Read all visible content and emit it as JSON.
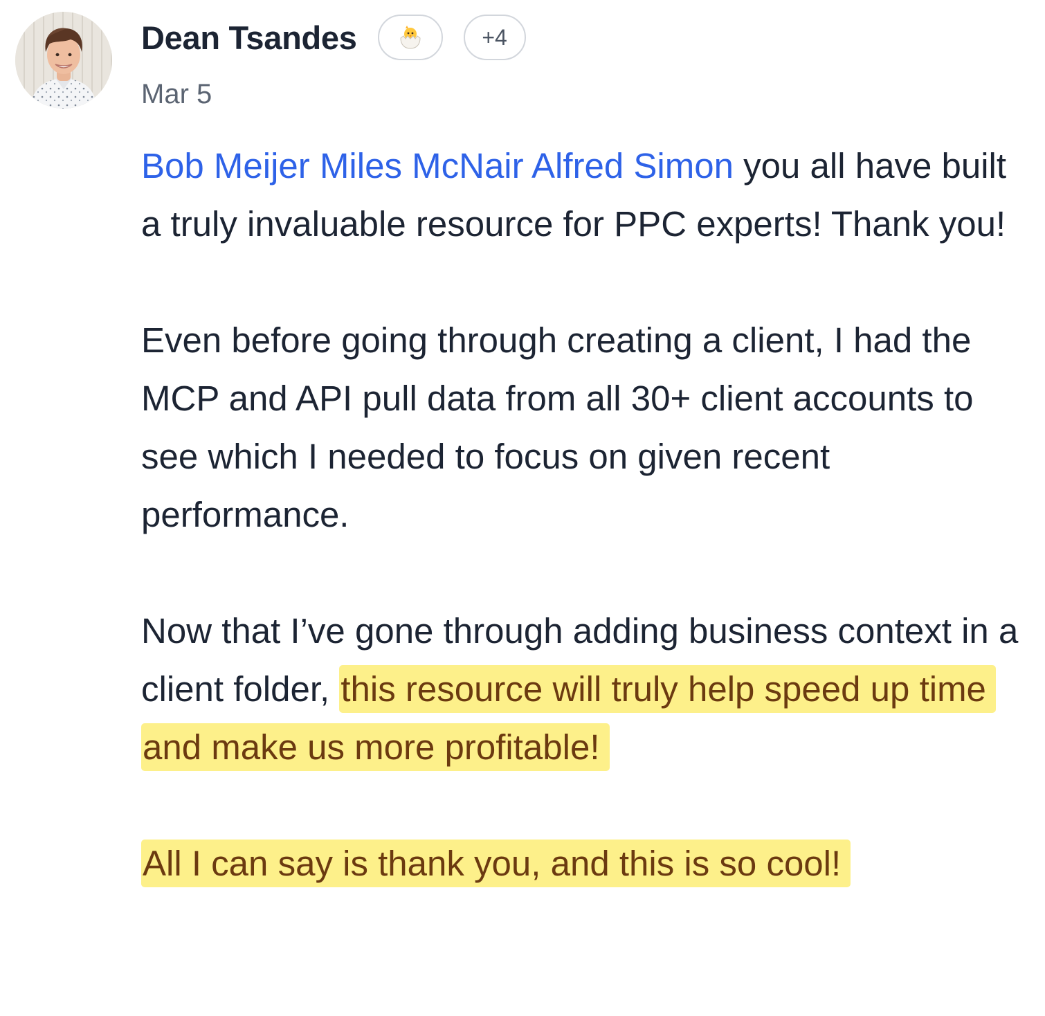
{
  "author": {
    "name": "Dean Tsandes",
    "date": "Mar 5",
    "avatar_icon": "profile-photo",
    "badges": [
      {
        "icon": "hatching-chick-emoji",
        "glyph": "🐣"
      },
      {
        "label": "+4"
      }
    ]
  },
  "post": {
    "paragraph1": {
      "mentions": [
        "Bob Meijer",
        "Miles McNair",
        "Alfred Simon"
      ],
      "text": " you all have built a truly invaluable resource for PPC experts! Thank you!"
    },
    "paragraph2": {
      "text": "Even before going through creating a client, I had the MCP and API pull data from all 30+ client accounts to see which I needed to focus on given recent performance."
    },
    "paragraph3": {
      "text": "Now that I’ve gone through adding business context in a client folder, ",
      "highlight": "this resource will truly help speed up time and make us more profitable!"
    },
    "paragraph4": {
      "highlight": "All I can say is thank you, and this is so cool!"
    }
  },
  "colors": {
    "mention": "#2e62e8",
    "highlight_bg": "#fdf08a",
    "highlight_text": "#6b3a10",
    "text": "#1c2433",
    "muted": "#5b6472"
  }
}
